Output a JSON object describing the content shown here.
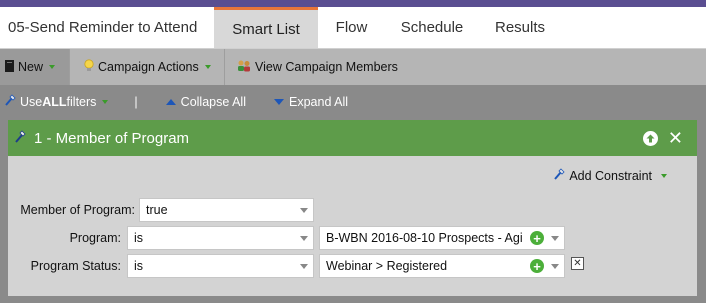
{
  "header": {
    "campaign_name": "05-Send Reminder to Attend",
    "tabs": [
      {
        "label": "Smart List",
        "active": true
      },
      {
        "label": "Flow",
        "active": false
      },
      {
        "label": "Schedule",
        "active": false
      },
      {
        "label": "Results",
        "active": false
      }
    ],
    "accent_color": "#e8763a",
    "top_stripe_color": "#5a4e91"
  },
  "toolbar": {
    "new_label": "New",
    "campaign_actions_label": "Campaign Actions",
    "view_members_label": "View Campaign Members"
  },
  "filterbar": {
    "use_prefix": "Use ",
    "use_bold": "ALL",
    "use_suffix": " filters",
    "separator": "|",
    "collapse_label": "Collapse All",
    "expand_label": "Expand All"
  },
  "filter": {
    "title": "1 - Member of Program",
    "header_color": "#5e9c4a",
    "add_constraint_label": "Add Constraint",
    "rows": [
      {
        "label": "Member of Program:",
        "operator": "true"
      },
      {
        "label": "Program:",
        "operator": "is",
        "value": "B-WBN 2016-08-10 Prospects - Agi"
      },
      {
        "label": "Program Status:",
        "operator": "is",
        "value": "Webinar > Registered"
      }
    ]
  },
  "icons": {
    "new": "document-icon",
    "campaign_actions": "lightbulb-icon",
    "view_members": "people-icon",
    "filters": "wand-icon",
    "move_up": "arrow-up-circle-icon",
    "close": "close-icon",
    "add": "plus-circle-icon",
    "delete": "delete-box-icon"
  }
}
